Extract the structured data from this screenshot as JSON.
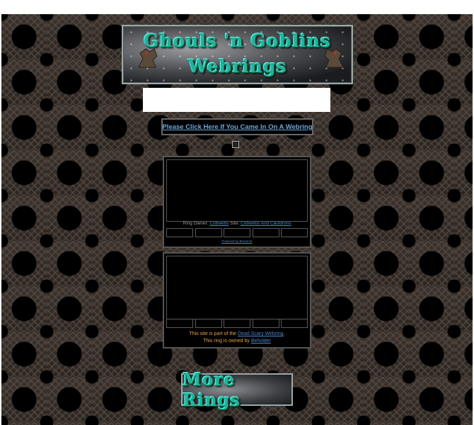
{
  "header": {
    "banner_title_line1": "Ghouls 'n Goblins",
    "banner_title_line2": "Webrings"
  },
  "came_in_link": "Please Click Here If You Came In On A Webring",
  "ring1": {
    "owner_label": "Ring Owner:",
    "owner_name": "Cobwebs",
    "site_label": "Site:",
    "site_name": "Cobwebs And Cauldrons",
    "powered_by": "Powered by Bravenet"
  },
  "ring2": {
    "part_of_prefix": "This site is part of the",
    "ring_name": "Dead Scary Webring",
    "part_of_suffix": ".",
    "owned_by_prefix": "This ring is owned by",
    "owner_name": "Beholder"
  },
  "more_rings_label": "More Rings",
  "colors": {
    "title_teal": "#1fb3a0",
    "link_blue": "#4c84c8",
    "text_orange": "#e2a24a"
  }
}
